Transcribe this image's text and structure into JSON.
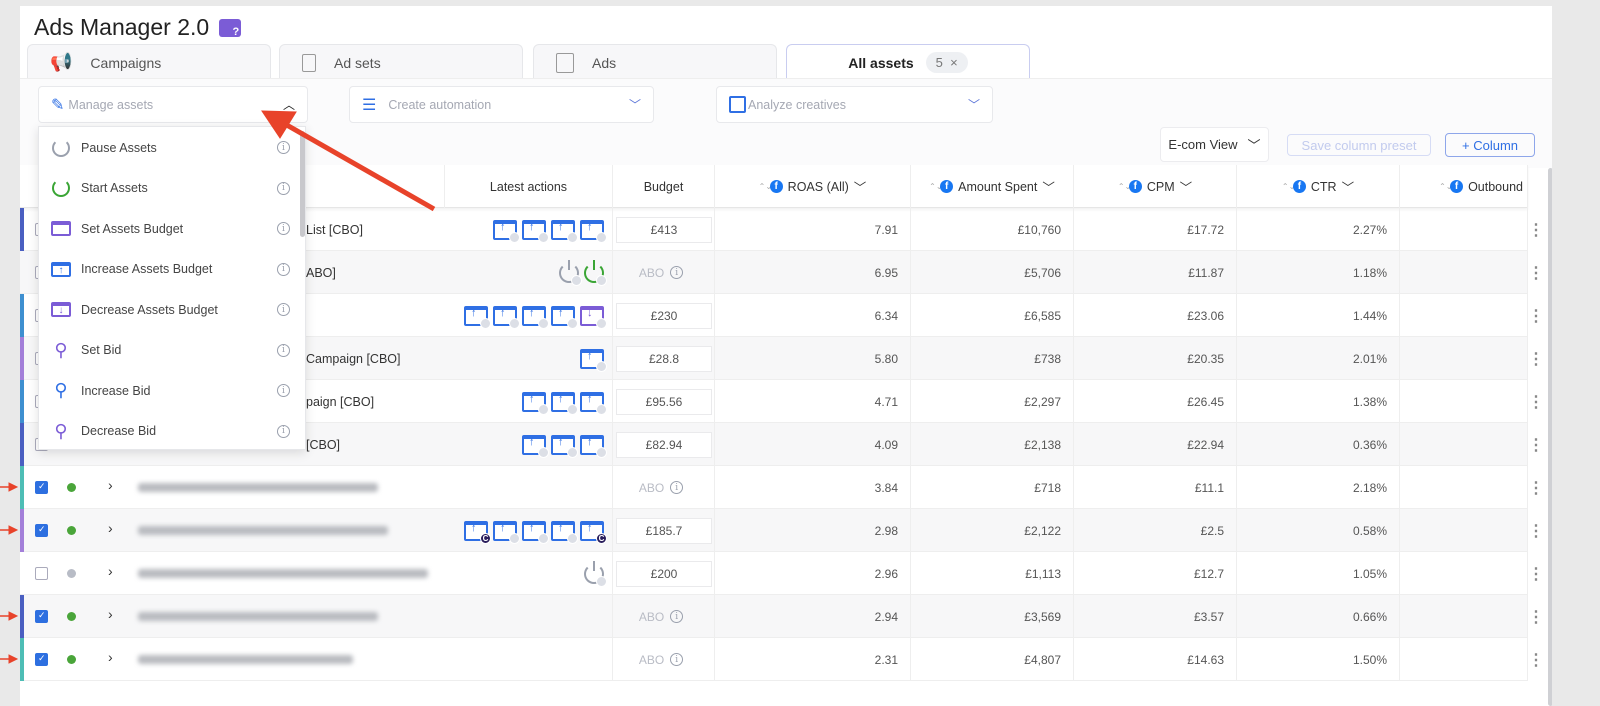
{
  "app": {
    "title": "Ads Manager 2.0"
  },
  "tabs": [
    {
      "label": "Campaigns",
      "icon": "megaphone-icon"
    },
    {
      "label": "Ad sets",
      "icon": "adsets-icon"
    },
    {
      "label": "Ads",
      "icon": "ad-icon"
    },
    {
      "label": "All assets",
      "count": "5",
      "close": "×",
      "active": true
    }
  ],
  "toolbar": {
    "manage": {
      "placeholder": "Manage assets",
      "open": true
    },
    "automation": {
      "placeholder": "Create automation"
    },
    "analyze": {
      "placeholder": "Analyze creatives"
    },
    "view": "E-com View",
    "save_preset": "Save column preset",
    "add_column": "+ Column"
  },
  "menu": {
    "items": [
      {
        "label": "Pause Assets",
        "icon": "power-off-icon"
      },
      {
        "label": "Start Assets",
        "icon": "power-on-icon"
      },
      {
        "label": "Set Assets Budget",
        "icon": "set-budget-icon"
      },
      {
        "label": "Increase Assets Budget",
        "icon": "increase-budget-icon"
      },
      {
        "label": "Decrease Assets Budget",
        "icon": "decrease-budget-icon"
      },
      {
        "label": "Set Bid",
        "icon": "bid-icon"
      },
      {
        "label": "Increase Bid",
        "icon": "increase-bid-icon"
      },
      {
        "label": "Decrease Bid",
        "icon": "decrease-bid-icon"
      }
    ],
    "info": "i"
  },
  "table": {
    "headers": {
      "actions": "Latest actions",
      "budget": "Budget",
      "roas": "ROAS (All)",
      "spent": "Amount Spent",
      "cpm": "CPM",
      "ctr": "CTR",
      "outbound": "Outbound"
    },
    "abo": "ABO",
    "rows": [
      {
        "color": "#4a5fc1",
        "checked": false,
        "name": "List [CBO]",
        "actions": [
          "up",
          "up",
          "up",
          "up"
        ],
        "budget": "£413",
        "roas": "7.91",
        "spent": "£10,760",
        "cpm": "£17.72",
        "ctr": "2.27%"
      },
      {
        "color": "",
        "checked": false,
        "name": "ABO]",
        "actions": [
          "off",
          "on"
        ],
        "budget": "ABO",
        "roas": "6.95",
        "spent": "£5,706",
        "cpm": "£11.87",
        "ctr": "1.18%"
      },
      {
        "color": "#3e8fd0",
        "checked": false,
        "name": "",
        "actions": [
          "up",
          "up",
          "up",
          "up",
          "down"
        ],
        "budget": "£230",
        "roas": "6.34",
        "spent": "£6,585",
        "cpm": "£23.06",
        "ctr": "1.44%"
      },
      {
        "color": "#a37fd9",
        "checked": false,
        "name": "Campaign [CBO]",
        "actions": [
          "up"
        ],
        "budget": "£28.8",
        "roas": "5.80",
        "spent": "£738",
        "cpm": "£20.35",
        "ctr": "2.01%"
      },
      {
        "color": "#3e8fd0",
        "checked": false,
        "name": "paign [CBO]",
        "actions": [
          "up",
          "up",
          "up"
        ],
        "budget": "£95.56",
        "roas": "4.71",
        "spent": "£2,297",
        "cpm": "£26.45",
        "ctr": "1.38%"
      },
      {
        "color": "#4a5fc1",
        "checked": false,
        "name": "[CBO]",
        "actions": [
          "up",
          "up",
          "up"
        ],
        "budget": "£82.94",
        "roas": "4.09",
        "spent": "£2,138",
        "cpm": "£22.94",
        "ctr": "0.36%"
      },
      {
        "color": "#4dbdb5",
        "checked": true,
        "status": "active",
        "actions": [],
        "budget": "ABO",
        "roas": "3.84",
        "spent": "£718",
        "cpm": "£11.1",
        "ctr": "2.18%"
      },
      {
        "color": "#a37fd9",
        "checked": true,
        "status": "active",
        "actions": [
          "upc",
          "up",
          "up",
          "up",
          "upc"
        ],
        "budget": "£185.7",
        "roas": "2.98",
        "spent": "£2,122",
        "cpm": "£2.5",
        "ctr": "0.58%"
      },
      {
        "color": "",
        "checked": false,
        "status": "inactive",
        "actions": [
          "off"
        ],
        "budget": "£200",
        "roas": "2.96",
        "spent": "£1,113",
        "cpm": "£12.7",
        "ctr": "1.05%"
      },
      {
        "color": "#4a5fc1",
        "checked": true,
        "status": "active",
        "actions": [],
        "budget": "ABO",
        "roas": "2.94",
        "spent": "£3,569",
        "cpm": "£3.57",
        "ctr": "0.66%"
      },
      {
        "color": "#4dbdb5",
        "checked": true,
        "status": "active",
        "actions": [],
        "budget": "ABO",
        "roas": "2.31",
        "spent": "£4,807",
        "cpm": "£14.63",
        "ctr": "1.50%"
      }
    ]
  },
  "colors": {
    "accent": "#2f6fe4",
    "purple": "#7b5cd6",
    "active": "#4aa53a",
    "annotation": "#e8432a"
  }
}
